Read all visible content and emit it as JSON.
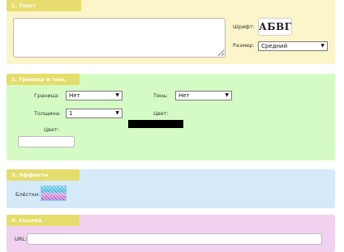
{
  "panels": {
    "text": {
      "tab": "1. Текст",
      "textarea_value": "",
      "font_label": "Шрифт:",
      "font_preview": "АБВГ",
      "size_label": "Размер:",
      "size_value": "Средний"
    },
    "border": {
      "tab": "2. Граница и тень",
      "border_label": "Граница:",
      "border_value": "Нет",
      "shadow_label": "Тень:",
      "shadow_value": "Нет",
      "thickness_label": "Толщина:",
      "thickness_value": "1",
      "shadow_color_label": "Цвет:",
      "shadow_color": "#000000",
      "border_color_label": "Цвет:",
      "border_color_value": ""
    },
    "effects": {
      "tab": "3. Эффекты",
      "glitter_label": "Блёстки:"
    },
    "link": {
      "tab": "4. Ссылка",
      "url_label": "URL:",
      "url_value": ""
    }
  },
  "colors": {
    "panel1_bg": "#fbf5c9",
    "panel2_bg": "#d5fbc5",
    "panel3_bg": "#d5e9f9",
    "panel4_bg": "#f1d1f0",
    "tab_bg": "#e4dd6c"
  }
}
